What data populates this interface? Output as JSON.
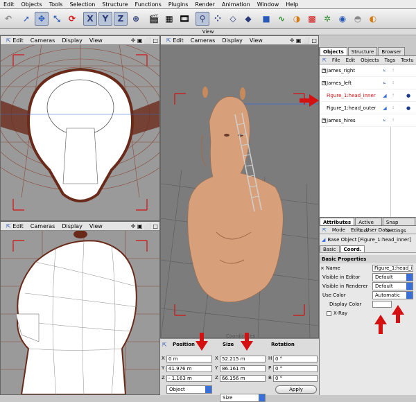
{
  "menubar": [
    "Edit",
    "Objects",
    "Tools",
    "Selection",
    "Structure",
    "Functions",
    "Plugins",
    "Render",
    "Animation",
    "Window",
    "Help"
  ],
  "toolbar": {
    "x_label": "X",
    "y_label": "Y",
    "z_label": "Z"
  },
  "view_title": "View",
  "viewports": {
    "menu": [
      "Edit",
      "Cameras",
      "Display",
      "View"
    ],
    "nav": "✛ ▣ ⬜ □"
  },
  "coord_manager": {
    "title": "Coordinates",
    "col_position": "Position",
    "col_size": "Size",
    "col_rotation": "Rotation",
    "rows": [
      {
        "axis": "X",
        "pos": "0 m",
        "size_axis": "X",
        "size": "52.215 m",
        "rot_axis": "H",
        "rot": "0 °"
      },
      {
        "axis": "Y",
        "pos": "41.976 m",
        "size_axis": "Y",
        "size": "86.161 m",
        "rot_axis": "P",
        "rot": "0 °"
      },
      {
        "axis": "Z",
        "pos": "- 1.163 m",
        "size_axis": "Z",
        "size": "66.156 m",
        "rot_axis": "B",
        "rot": "0 °"
      }
    ],
    "mode_select": "Object",
    "size_select": "Size",
    "apply_label": "Apply"
  },
  "object_manager": {
    "tabs": [
      "Objects",
      "Structure",
      "Browser"
    ],
    "menu": [
      "File",
      "Edit",
      "Objects",
      "Tags",
      "Textu"
    ],
    "objects": [
      {
        "name": "James_right",
        "color": "#000000"
      },
      {
        "name": "James_left",
        "color": "#000000"
      },
      {
        "name": "Figure_1:head_inner",
        "color": "#d41010"
      },
      {
        "name": "Figure_1:head_outer",
        "color": "#000000"
      },
      {
        "name": "James_hires",
        "color": "#000000"
      }
    ]
  },
  "attributes": {
    "tabs": [
      "Attributes",
      "Active Tool",
      "Snap Settings"
    ],
    "menu": [
      "Mode",
      "Edit",
      "User Data"
    ],
    "object_title": "Base Object [Figure_1:head_inner]",
    "subtabs": [
      "Basic",
      "Coord."
    ],
    "section": "Basic Properties",
    "fields": [
      {
        "label": "× Name",
        "value": "Figure_1:head_in"
      },
      {
        "label": "Visible in Editor",
        "value": "Default"
      },
      {
        "label": "Visible in Renderer",
        "value": "Default"
      },
      {
        "label": "Use Color",
        "value": "Automatic"
      }
    ],
    "display_color_label": "Display Color",
    "xray_label": "X-Ray"
  },
  "colors": {
    "accent_red": "#d41010",
    "select_blue": "#3a6fd8",
    "wire_brown": "#8a4a3a"
  }
}
